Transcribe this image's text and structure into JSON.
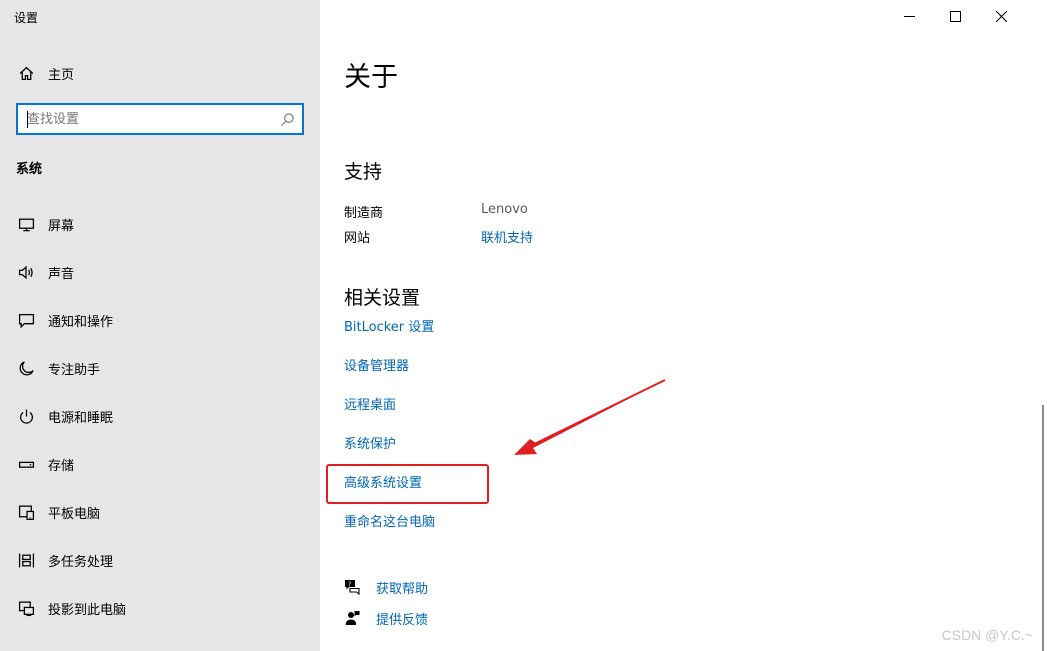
{
  "window": {
    "app_title": "设置",
    "controls": {
      "minimize": "minimize",
      "maximize": "maximize",
      "close": "close"
    }
  },
  "sidebar": {
    "home_label": "主页",
    "search": {
      "value": "",
      "placeholder": "查找设置"
    },
    "section_title": "系统",
    "items": [
      {
        "label": "屏幕",
        "icon": "monitor-icon"
      },
      {
        "label": "声音",
        "icon": "speaker-icon"
      },
      {
        "label": "通知和操作",
        "icon": "message-icon"
      },
      {
        "label": "专注助手",
        "icon": "moon-icon"
      },
      {
        "label": "电源和睡眠",
        "icon": "power-icon"
      },
      {
        "label": "存储",
        "icon": "storage-icon"
      },
      {
        "label": "平板电脑",
        "icon": "tablet-icon"
      },
      {
        "label": "多任务处理",
        "icon": "multitask-icon"
      },
      {
        "label": "投影到此电脑",
        "icon": "project-icon"
      }
    ]
  },
  "main": {
    "title": "关于",
    "support": {
      "heading": "支持",
      "manufacturer_label": "制造商",
      "manufacturer_value": "Lenovo",
      "website_label": "网站",
      "website_link": "联机支持"
    },
    "related": {
      "heading": "相关设置",
      "links": [
        "BitLocker 设置",
        "设备管理器",
        "远程桌面",
        "系统保护",
        "高级系统设置",
        "重命名这台电脑"
      ]
    },
    "help": {
      "get_help": "获取帮助",
      "give_feedback": "提供反馈"
    }
  },
  "watermark": "CSDN @Y.C.~",
  "colors": {
    "accent": "#0078d7",
    "link": "#0067b8",
    "sidebar_bg": "#e6e6e6",
    "annotation": "#e02020"
  }
}
